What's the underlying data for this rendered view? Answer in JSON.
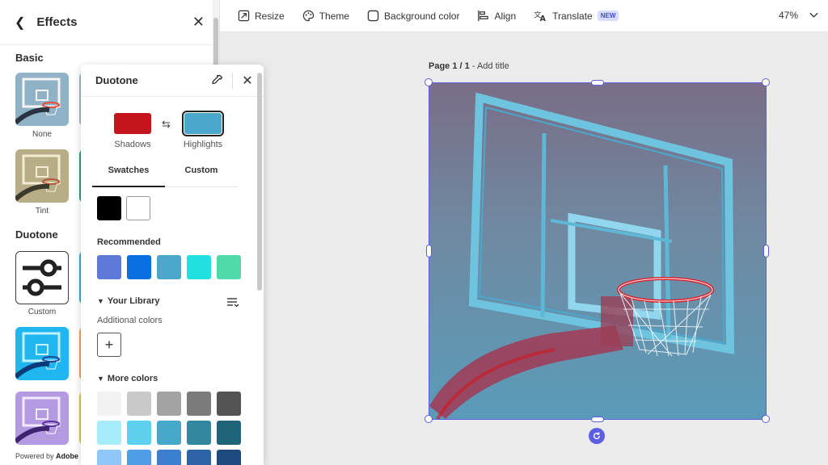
{
  "effects_panel": {
    "title": "Effects",
    "sections": {
      "basic": "Basic",
      "duotone": "Duotone"
    },
    "thumbs": {
      "none": "None",
      "tint": "Tint",
      "custom": "Custom"
    },
    "powered_prefix": "Powered by",
    "powered_brand": "Adobe I"
  },
  "duotone_popover": {
    "title": "Duotone",
    "shadows": {
      "label": "Shadows",
      "color": "#c4151c"
    },
    "highlights": {
      "label": "Highlights",
      "color": "#4aa8cd"
    },
    "tabs": [
      "Swatches",
      "Custom"
    ],
    "basic_swatches": [
      "#000000",
      "#ffffff"
    ],
    "recommended_title": "Recommended",
    "recommended": [
      "#5f79d8",
      "#0a6fe0",
      "#4aa8cd",
      "#22dfe0",
      "#4fd9a9"
    ],
    "library_title": "Your Library",
    "additional_colors": "Additional colors",
    "add_label": "+",
    "more_colors_title": "More colors",
    "more_colors_rows": [
      [
        "#f2f2f2",
        "#c8c8c8",
        "#a3a3a3",
        "#7b7b7b",
        "#545454"
      ],
      [
        "#a7ecfb",
        "#5fcfee",
        "#47a9c9",
        "#33879f",
        "#1f6478"
      ],
      [
        "#8fc8f8",
        "#4f9ce7",
        "#3b7fd0",
        "#2d62a7",
        "#1f4a80"
      ]
    ]
  },
  "toolbar": {
    "resize": "Resize",
    "theme": "Theme",
    "background_color": "Background color",
    "align": "Align",
    "translate": "Translate",
    "translate_badge": "NEW",
    "zoom": "47%"
  },
  "canvas": {
    "page_label": "Page 1 / 1",
    "page_separator": " - ",
    "add_title": "Add title"
  }
}
